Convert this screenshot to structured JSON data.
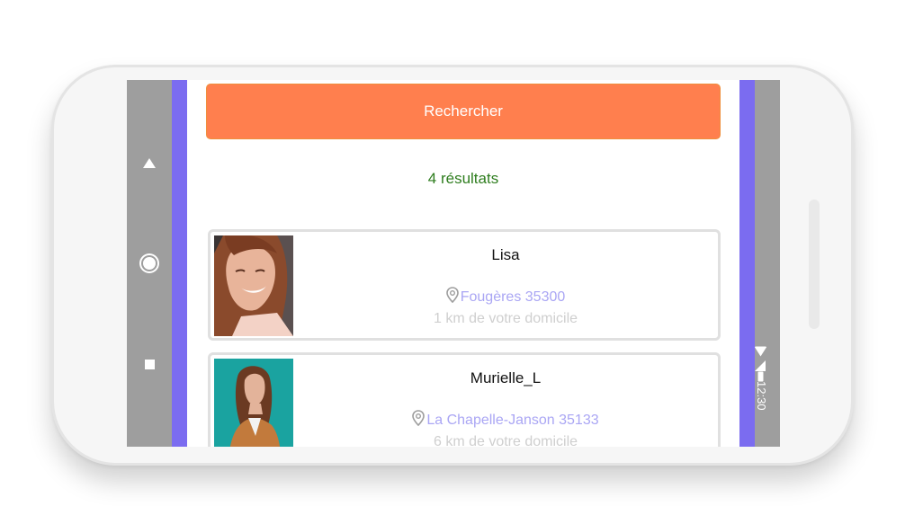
{
  "navigation": {
    "back_icon": "triangle-up-icon",
    "home_icon": "circle-home-icon",
    "recent_icon": "square-recent-icon"
  },
  "status": {
    "time": "12:30",
    "icons": [
      "wifi-icon",
      "signal-icon",
      "battery-icon"
    ]
  },
  "search": {
    "button_label": "Rechercher"
  },
  "results": {
    "count_label": "4 résultats"
  },
  "profiles": [
    {
      "name": "Lisa",
      "location": "Fougères 35300",
      "distance": "1 km de votre domicile"
    },
    {
      "name": "Murielle_L",
      "location": "La Chapelle-Janson 35133",
      "distance": "6 km de votre domicile"
    }
  ],
  "colors": {
    "accent_orange": "#ff7f4e",
    "side_purple": "#7b6cf0",
    "results_green": "#2e7d1e",
    "location_lavender": "#aaa6f4"
  }
}
